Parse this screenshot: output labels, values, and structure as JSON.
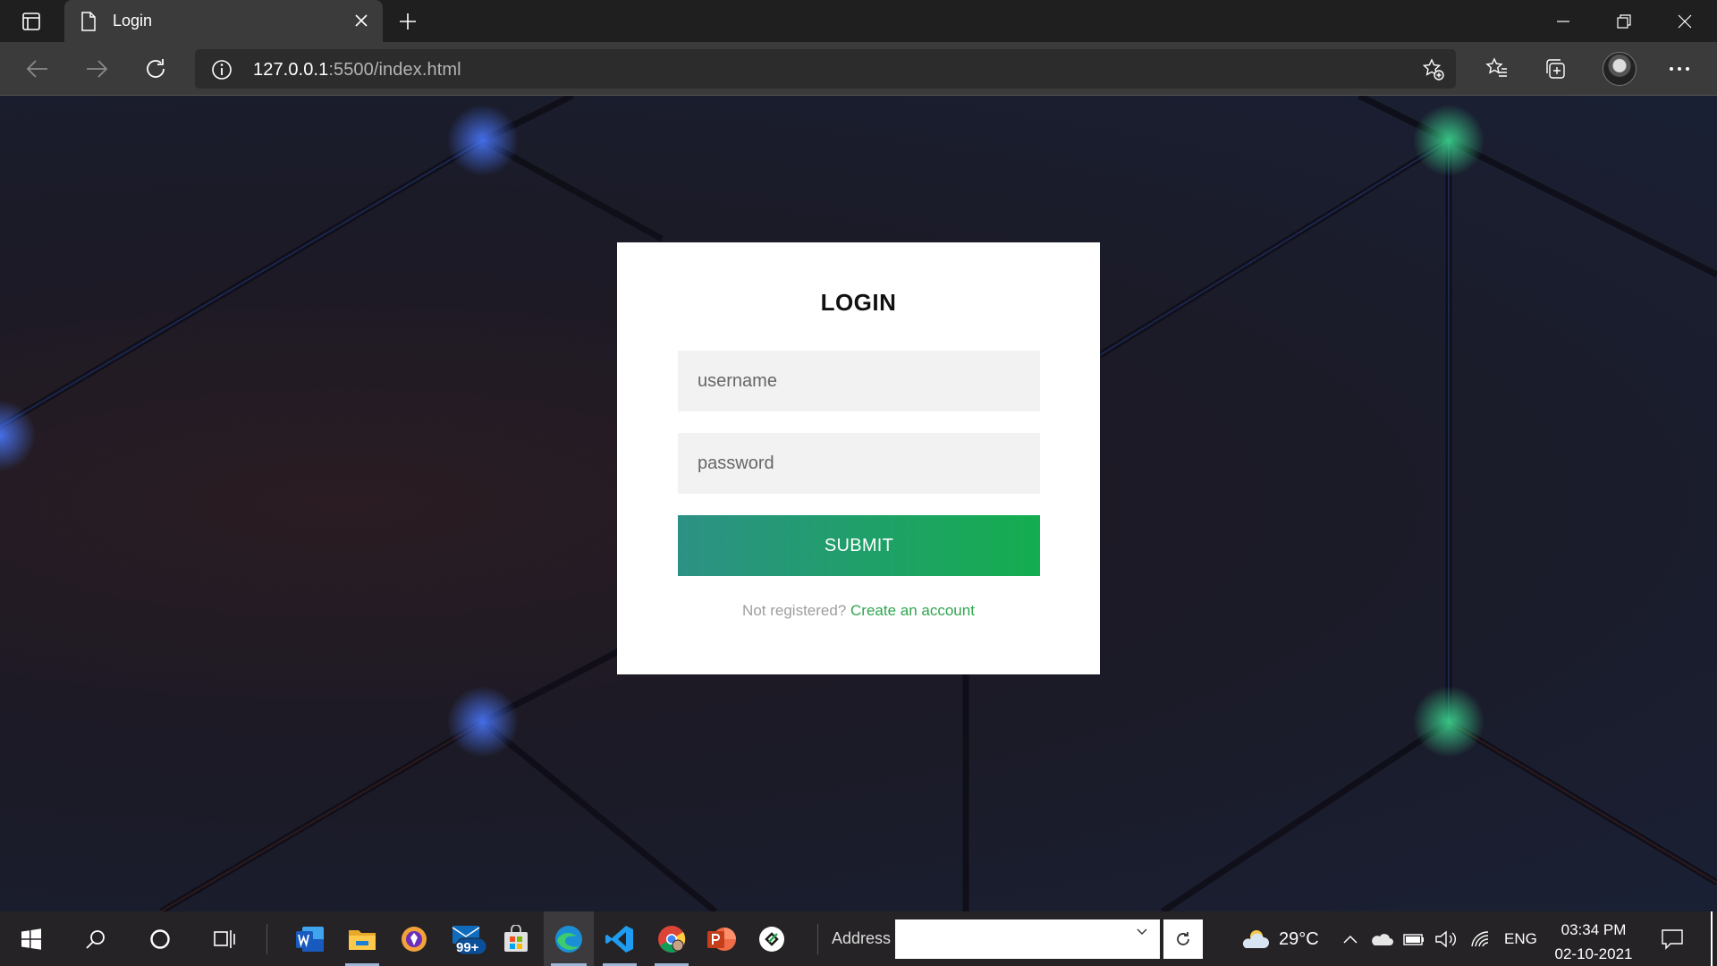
{
  "browser": {
    "tab_title": "Login",
    "url_host": "127.0.0.1",
    "url_rest": ":5500/index.html",
    "icons": [
      "tab-actions-icon",
      "page-icon",
      "close-icon",
      "plus-icon",
      "minimize-icon",
      "restore-icon",
      "close-window-icon",
      "back-icon",
      "forward-icon",
      "refresh-icon",
      "info-icon",
      "add-favorite-icon",
      "favorites-icon",
      "collections-icon",
      "profile-avatar",
      "more-icon"
    ]
  },
  "login": {
    "heading": "LOGIN",
    "username_placeholder": "username",
    "password_placeholder": "password",
    "submit_label": "SUBMIT",
    "register_prompt": "Not registered?",
    "register_link": "Create an account"
  },
  "colors": {
    "submit_gradient_start": "#2c9185",
    "submit_gradient_end": "#14ad4f",
    "link": "#2ea64e"
  },
  "taskbar": {
    "address_label": "Address",
    "mail_badge": "99+",
    "temperature": "29°C",
    "language": "ENG",
    "time": "03:34 PM",
    "date": "02-10-2021",
    "apps": [
      "windows-start-icon",
      "search-icon",
      "cortana-icon",
      "task-view-icon",
      "word-icon",
      "file-explorer-icon",
      "brave-icon",
      "mail-icon",
      "store-icon",
      "edge-icon",
      "vscode-icon",
      "chrome-icon",
      "powerpoint-icon",
      "app-icon"
    ]
  }
}
